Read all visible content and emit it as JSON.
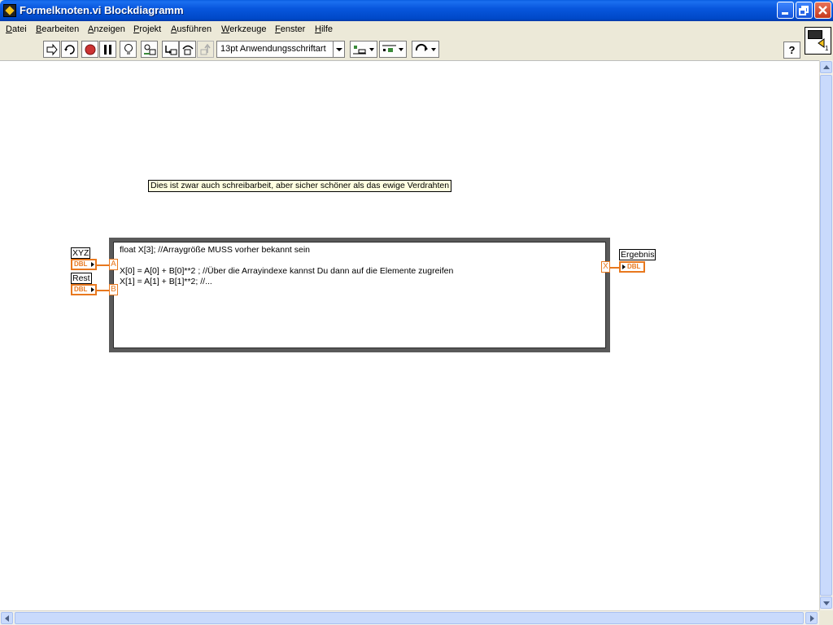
{
  "window": {
    "title": "Formelknoten.vi Blockdiagramm"
  },
  "menu": {
    "items": [
      "Datei",
      "Bearbeiten",
      "Anzeigen",
      "Projekt",
      "Ausführen",
      "Werkzeuge",
      "Fenster",
      "Hilfe"
    ]
  },
  "toolbar": {
    "font_select": "13pt Anwendungsschriftart",
    "help_label": "?"
  },
  "vi_icon": {
    "connector_label": "1"
  },
  "diagram": {
    "comment": "Dies ist zwar auch schreibarbeit, aber sicher schöner als das ewige Verdrahten",
    "inputs": [
      {
        "label": "XYZ",
        "type": "DBL",
        "variable": "A"
      },
      {
        "label": "Rest",
        "type": "DBL",
        "variable": "B"
      }
    ],
    "output": {
      "label": "Ergebnis",
      "type": "DBL",
      "variable": "X"
    },
    "formula_lines": [
      "float X[3]; //Arraygröße MUSS vorher bekannt sein",
      "",
      "X[0] = A[0] + B[0]**2 ; //Über die Arrayindexe kannst Du dann auf die Elemente zugreifen",
      "X[1] = A[1] + B[1]**2; //..."
    ]
  },
  "colors": {
    "titlebar": "#0a5ee0",
    "wire_dbl": "#e8781e",
    "comment_bg": "#ffffe0"
  }
}
